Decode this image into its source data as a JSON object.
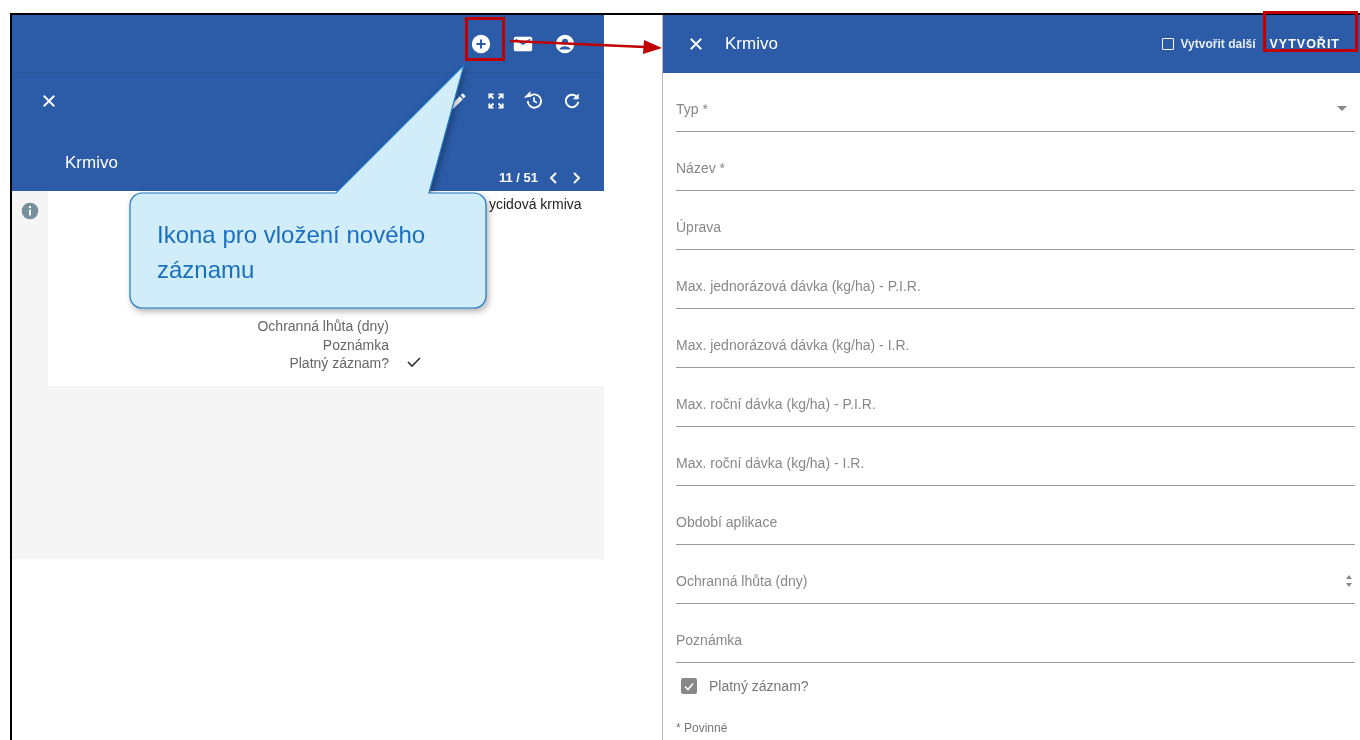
{
  "left": {
    "title": "Krmivo",
    "pager": "11 / 51",
    "detail_value": "ycidová krmiva",
    "details": [
      {
        "label": "Ochranná lhůta (dny)",
        "kind": "text"
      },
      {
        "label": "Poznámka",
        "kind": "text"
      },
      {
        "label": "Platný záznam?",
        "kind": "boolean",
        "checked": true
      }
    ]
  },
  "callout": {
    "text": "Ikona pro vložení nového záznamu"
  },
  "form": {
    "title": "Krmivo",
    "create_another": {
      "label": "Vytvořit další",
      "checked": false
    },
    "submit": "VYTVOŘIT",
    "fields": [
      {
        "label": "Typ *",
        "kind": "select"
      },
      {
        "label": "Název *",
        "kind": "text"
      },
      {
        "label": "Úprava",
        "kind": "text"
      },
      {
        "label": "Max. jednorázová dávka (kg/ha) - P.I.R.",
        "kind": "text"
      },
      {
        "label": "Max. jednorázová dávka (kg/ha) - I.R.",
        "kind": "text"
      },
      {
        "label": "Max. roční dávka (kg/ha) - P.I.R.",
        "kind": "text"
      },
      {
        "label": "Max. roční dávka (kg/ha) - I.R.",
        "kind": "text"
      },
      {
        "label": "Období aplikace",
        "kind": "text"
      },
      {
        "label": "Ochranná lhůta (dny)",
        "kind": "number"
      },
      {
        "label": "Poznámka",
        "kind": "text"
      }
    ],
    "valid": {
      "label": "Platný záznam?",
      "checked": true
    },
    "required_note": "* Povinné"
  }
}
